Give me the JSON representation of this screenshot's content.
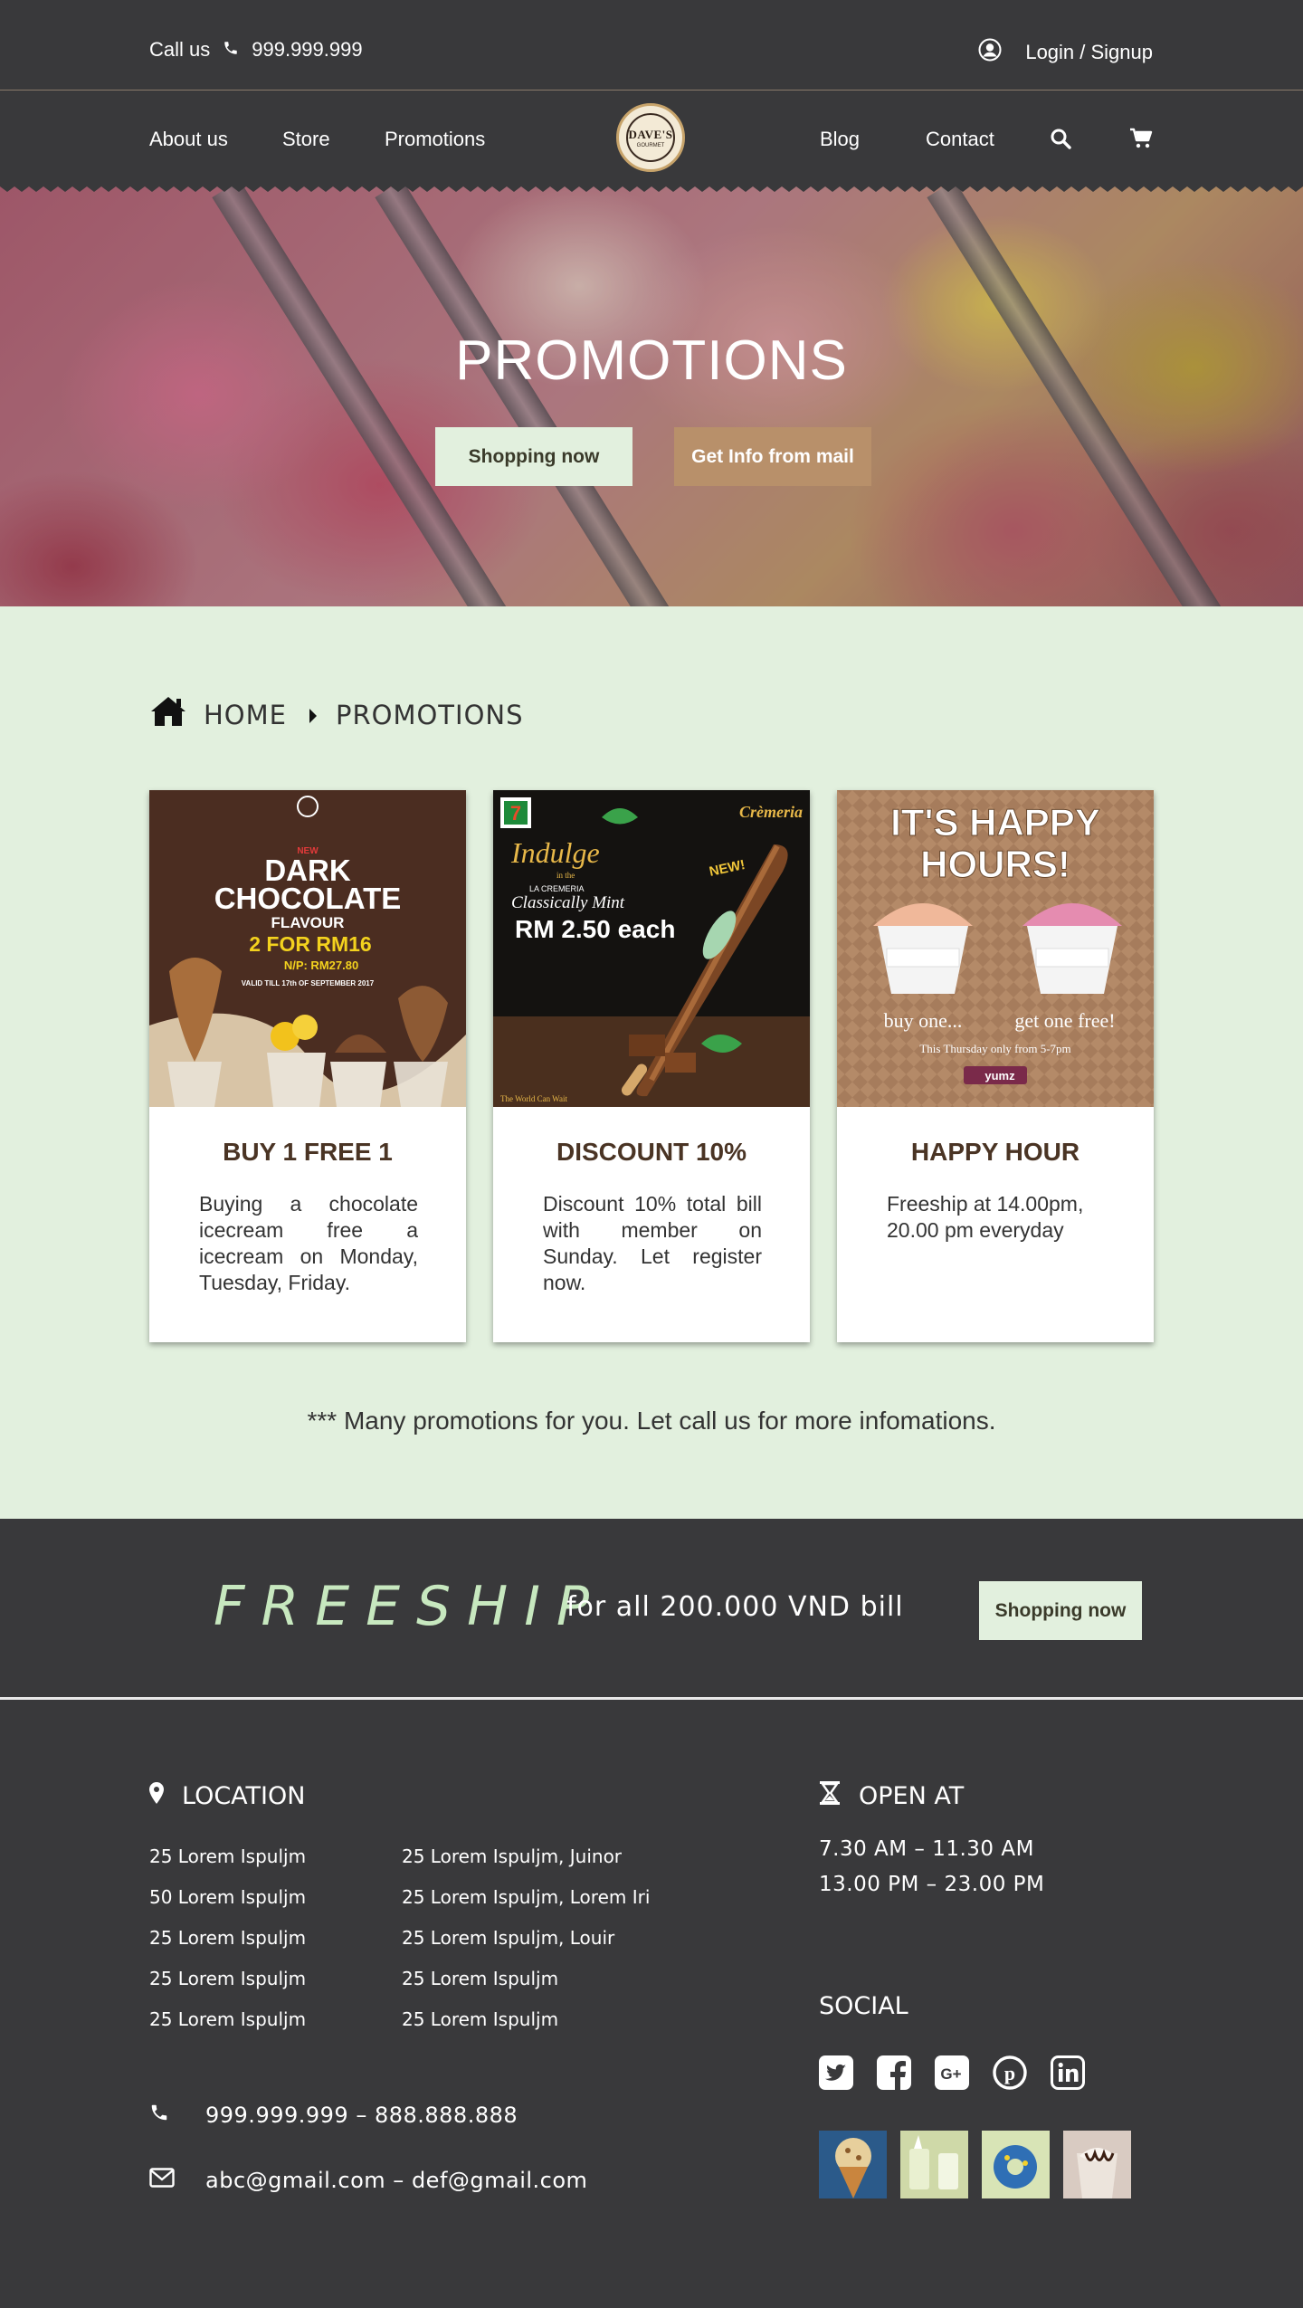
{
  "topbar": {
    "call_label": "Call us",
    "phone": "999.999.999",
    "login_label": "Login / Signup"
  },
  "nav": {
    "items_left": [
      "About us",
      "Store",
      "Promotions"
    ],
    "items_right": [
      "Blog",
      "Contact"
    ],
    "logo_text": "DAVE'S",
    "logo_sub": "GOURMET"
  },
  "hero": {
    "title": "PROMOTIONS",
    "btn_shop": "Shopping now",
    "btn_mail": "Get Info from mail"
  },
  "breadcrumb": {
    "home": "HOME",
    "current": "PROMOTIONS"
  },
  "promos": [
    {
      "title": "BUY 1 FREE 1",
      "desc": "Buying a chocolate icecream free a icecream on Monday, Tuesday, Friday.",
      "img": {
        "l1": "NEW",
        "l2": "DARK",
        "l3": "CHOCOLATE",
        "l4": "FLAVOUR",
        "l5": "2 FOR RM16",
        "l6": "N/P: RM27.80",
        "l7": "VALID TILL 17th OF SEPTEMBER 2017"
      }
    },
    {
      "title": "DISCOUNT 10%",
      "desc": "Discount 10% total bill with member on Sunday. Let register now.",
      "img": {
        "l1": "Indulge",
        "l2": "in the",
        "l3": "LA CREMERIA",
        "l4": "Classically Mint",
        "l5": "RM 2.50 each",
        "l6": "NEW!",
        "l7": "Crèmeria",
        "l8": "The World Can Wait"
      }
    },
    {
      "title": "HAPPY HOUR",
      "desc": "Freeship at 14.00pm, 20.00 pm everyday",
      "img": {
        "l1": "IT'S HAPPY",
        "l2": "HOURS!",
        "l3": "buy one...",
        "l4": "get one free!",
        "l5": "This Thursday only from 5-7pm",
        "l6": "yumz"
      }
    }
  ],
  "note": "*** Many promotions for you. Let call us for more infomations.",
  "freeship": {
    "big": "FREESHIP",
    "text": "for all 200.000 VND bill",
    "btn": "Shopping now"
  },
  "footer": {
    "location_title": "LOCATION",
    "loc_col1": [
      "25 Lorem Ispuljm",
      "50 Lorem Ispuljm",
      "25 Lorem Ispuljm",
      "25 Lorem Ispuljm",
      "25 Lorem Ispuljm"
    ],
    "loc_col2": [
      "25 Lorem Ispuljm, Juinor",
      "25 Lorem Ispuljm, Lorem Iri",
      "25 Lorem Ispuljm, Louir",
      "25 Lorem Ispuljm",
      "25 Lorem Ispuljm"
    ],
    "open_title": "OPEN AT",
    "hours": [
      "7.30 AM  – 11.30 AM",
      "13.00 PM  – 23.00 PM"
    ],
    "social_title": "SOCIAL",
    "phones": "999.999.999 – 888.888.888",
    "emails": "abc@gmail.com – def@gmail.com"
  },
  "colors": {
    "dark": "#39393b",
    "mint": "#e2f0de",
    "tan": "#b8906a",
    "brown": "#4a3424",
    "freeship_green": "#c7e8bf"
  }
}
